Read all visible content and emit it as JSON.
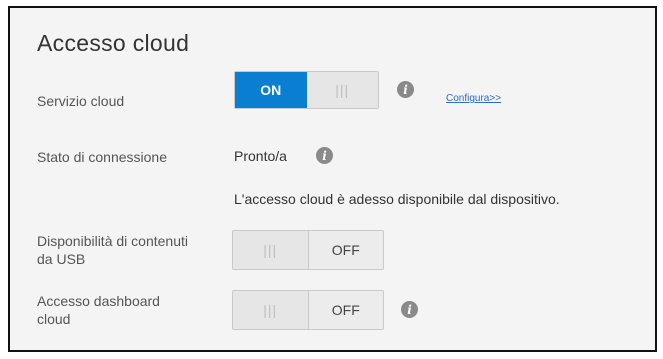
{
  "panel": {
    "title": "Accesso cloud",
    "cloud_service": {
      "label": "Servizio cloud",
      "on": "ON",
      "grip": "|||",
      "link": "Configura>>"
    },
    "connection_status": {
      "label": "Stato di connessione",
      "value": "Pronto/a"
    },
    "message": "L'accesso cloud è adesso disponibile dal dispositivo.",
    "usb_content": {
      "label": "Disponibilità di contenuti da USB",
      "grip": "|||",
      "off": "OFF"
    },
    "dashboard_access": {
      "label": "Accesso dashboard cloud",
      "grip": "|||",
      "off": "OFF"
    },
    "info_glyph": "i"
  }
}
